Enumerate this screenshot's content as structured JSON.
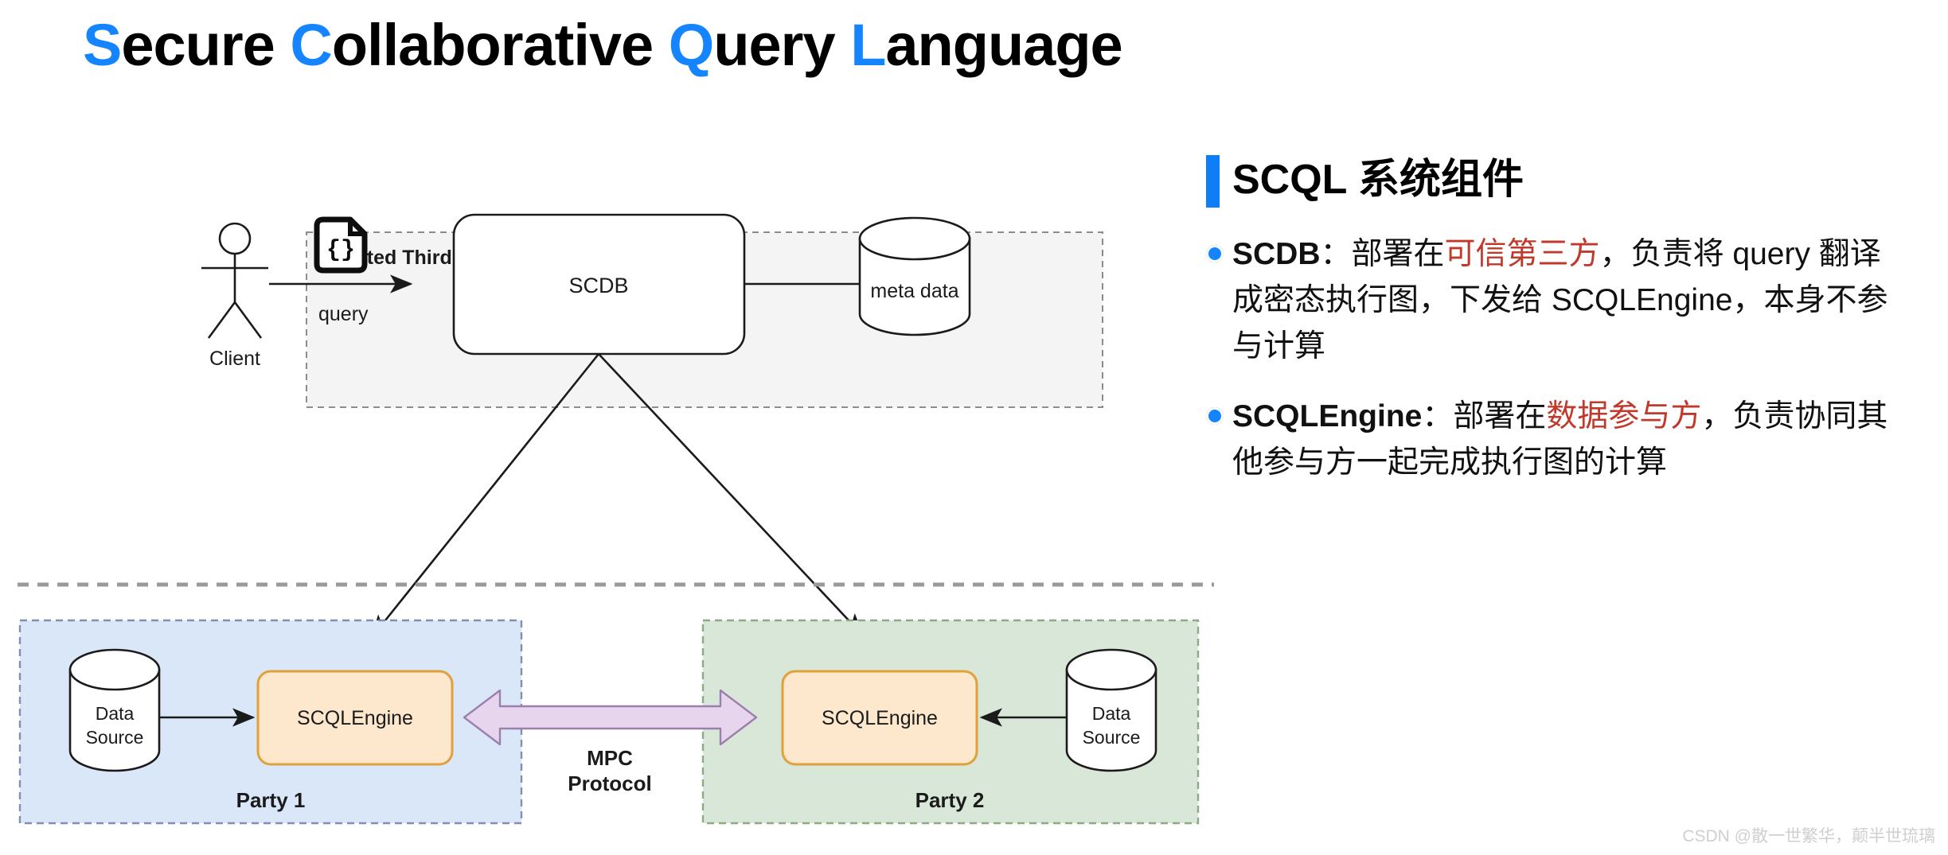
{
  "title": {
    "words": [
      {
        "initial": "S",
        "rest": "ecure"
      },
      {
        "initial": "C",
        "rest": "ollaborative"
      },
      {
        "initial": "Q",
        "rest": "uery"
      },
      {
        "initial": "L",
        "rest": "anguage"
      }
    ],
    "full_text": "Secure Collaborative Query Language",
    "accent_color": "#1585ff"
  },
  "panel": {
    "heading": "SCQL 系统组件",
    "accent_bar_color": "#0d7ef5",
    "bullets": [
      {
        "term": "SCDB",
        "separator": "：",
        "segments": [
          {
            "text": "部署在",
            "style": "normal"
          },
          {
            "text": "可信第三方",
            "style": "highlight"
          },
          {
            "text": "，负责将 query 翻译成密态执行图，下发给 SCQLEngine，本身不参与计算",
            "style": "normal"
          }
        ],
        "full_text": "SCDB：部署在可信第三方，负责将 query 翻译成密态执行图，下发给 SCQLEngine，本身不参与计算",
        "marker_color": "#1585ff",
        "highlight_color": "#c0392b"
      },
      {
        "term": "SCQLEngine",
        "separator": "：",
        "segments": [
          {
            "text": "部署在",
            "style": "normal"
          },
          {
            "text": "数据参与方",
            "style": "highlight"
          },
          {
            "text": "，负责协同其他参与方一起完成执行图的计算",
            "style": "normal"
          }
        ],
        "full_text": "SCQLEngine：部署在数据参与方，负责协同其他参与方一起完成执行图的计算",
        "marker_color": "#1585ff",
        "highlight_color": "#c0392b"
      }
    ]
  },
  "diagram": {
    "trusted_zone": {
      "label": "Trusted Third Party",
      "fill": "#f4f4f4",
      "stroke": "#8c8c8c"
    },
    "client": {
      "label": "Client",
      "icon": "actor-stick-figure"
    },
    "query_flow": {
      "label": "query",
      "icon": "json-document-icon",
      "icon_glyph": "{}"
    },
    "scdb": {
      "label": "SCDB",
      "fill": "#ffffff",
      "stroke": "#1b1b1b"
    },
    "metadata_store": {
      "label": "meta data",
      "icon": "database-cylinder-icon",
      "fill": "#ffffff",
      "stroke": "#1b1b1b"
    },
    "divider": {
      "name": "zone-divider",
      "style": "dashed",
      "color": "#9a9a9a"
    },
    "mpc": {
      "label_line1": "MPC",
      "label_line2": "Protocol",
      "arrow_fill": "#e6d5ec",
      "arrow_stroke": "#9b7fae"
    },
    "parties": [
      {
        "label": "Party 1",
        "fill": "#dae7f9",
        "stroke": "#7f91ad",
        "engine": {
          "label": "SCQLEngine",
          "fill": "#fde8cd",
          "stroke": "#e0a03a"
        },
        "data_source": {
          "line1": "Data",
          "line2": "Source",
          "icon": "database-cylinder-icon"
        }
      },
      {
        "label": "Party 2",
        "fill": "#d9e7d8",
        "stroke": "#8aab86",
        "engine": {
          "label": "SCQLEngine",
          "fill": "#fde8cd",
          "stroke": "#e0a03a"
        },
        "data_source": {
          "line1": "Data",
          "line2": "Source",
          "icon": "database-cylinder-icon"
        }
      }
    ]
  },
  "watermark": {
    "text": "CSDN @散一世繁华，颠半世琉璃"
  }
}
